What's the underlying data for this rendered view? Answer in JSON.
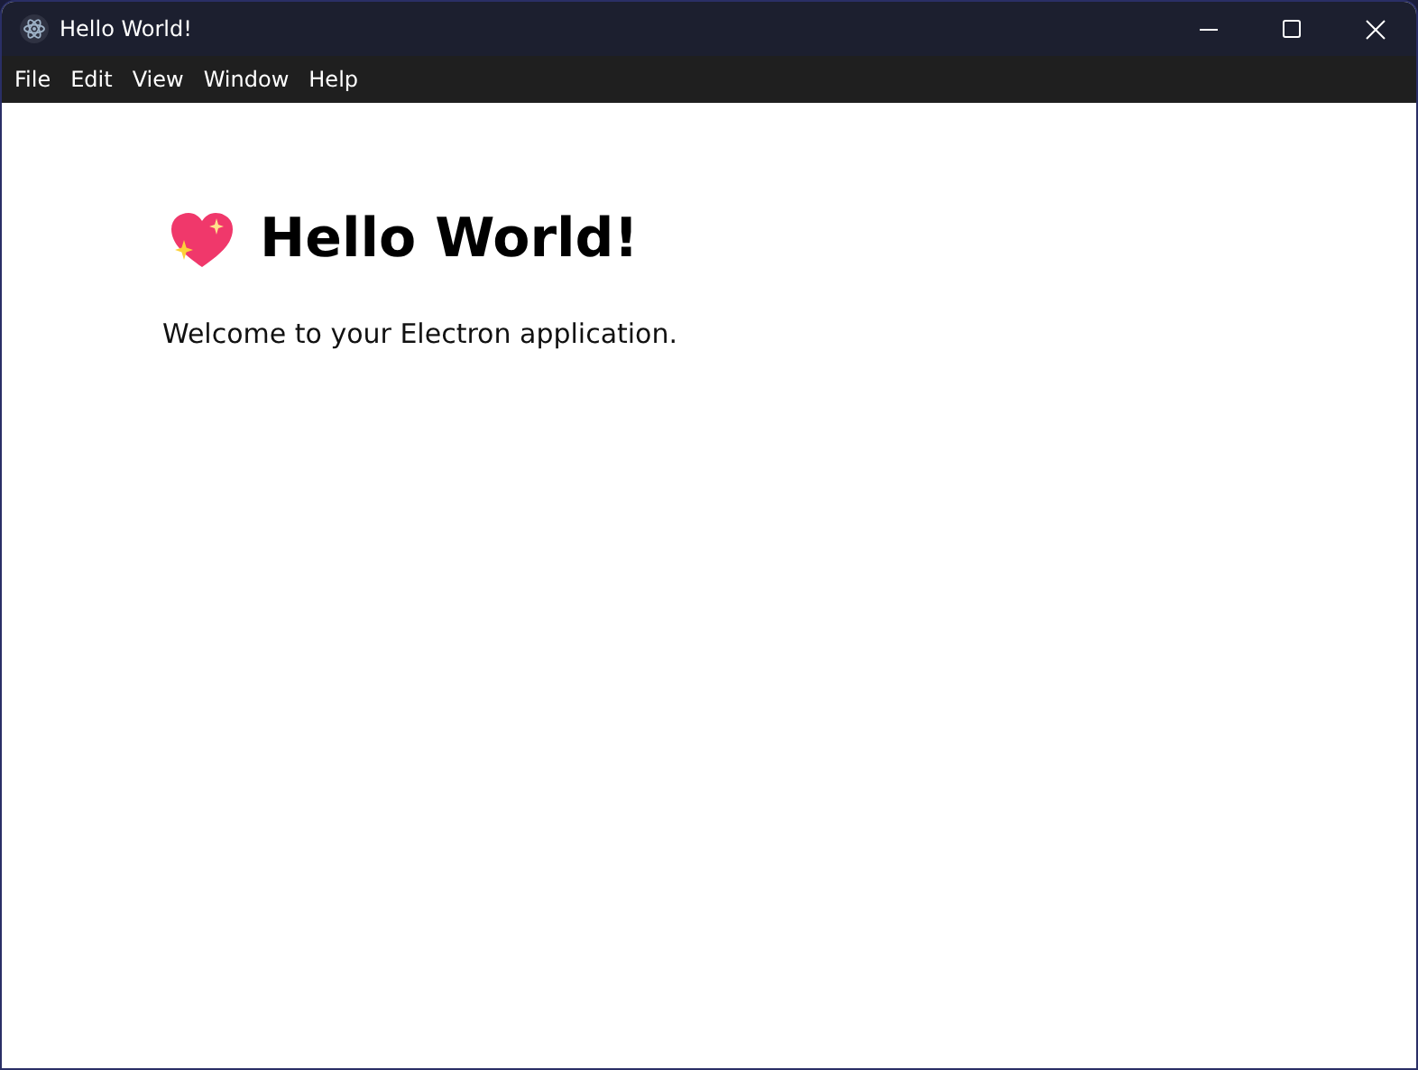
{
  "window": {
    "title": "Hello World!"
  },
  "menu": [
    "File",
    "Edit",
    "View",
    "Window",
    "Help"
  ],
  "heading": "Hello World!",
  "paragraph": "Welcome to your Electron application."
}
